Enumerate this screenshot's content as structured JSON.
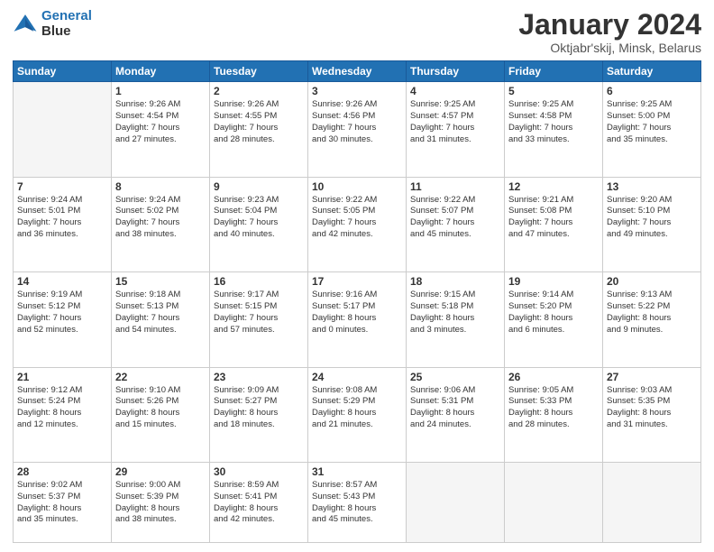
{
  "logo": {
    "line1": "General",
    "line2": "Blue"
  },
  "title": "January 2024",
  "location": "Oktjabr'skij, Minsk, Belarus",
  "days_header": [
    "Sunday",
    "Monday",
    "Tuesday",
    "Wednesday",
    "Thursday",
    "Friday",
    "Saturday"
  ],
  "weeks": [
    [
      {
        "num": "",
        "empty": true
      },
      {
        "num": "1",
        "sunrise": "Sunrise: 9:26 AM",
        "sunset": "Sunset: 4:54 PM",
        "daylight": "Daylight: 7 hours and 27 minutes."
      },
      {
        "num": "2",
        "sunrise": "Sunrise: 9:26 AM",
        "sunset": "Sunset: 4:55 PM",
        "daylight": "Daylight: 7 hours and 28 minutes."
      },
      {
        "num": "3",
        "sunrise": "Sunrise: 9:26 AM",
        "sunset": "Sunset: 4:56 PM",
        "daylight": "Daylight: 7 hours and 30 minutes."
      },
      {
        "num": "4",
        "sunrise": "Sunrise: 9:25 AM",
        "sunset": "Sunset: 4:57 PM",
        "daylight": "Daylight: 7 hours and 31 minutes."
      },
      {
        "num": "5",
        "sunrise": "Sunrise: 9:25 AM",
        "sunset": "Sunset: 4:58 PM",
        "daylight": "Daylight: 7 hours and 33 minutes."
      },
      {
        "num": "6",
        "sunrise": "Sunrise: 9:25 AM",
        "sunset": "Sunset: 5:00 PM",
        "daylight": "Daylight: 7 hours and 35 minutes."
      }
    ],
    [
      {
        "num": "7",
        "sunrise": "Sunrise: 9:24 AM",
        "sunset": "Sunset: 5:01 PM",
        "daylight": "Daylight: 7 hours and 36 minutes."
      },
      {
        "num": "8",
        "sunrise": "Sunrise: 9:24 AM",
        "sunset": "Sunset: 5:02 PM",
        "daylight": "Daylight: 7 hours and 38 minutes."
      },
      {
        "num": "9",
        "sunrise": "Sunrise: 9:23 AM",
        "sunset": "Sunset: 5:04 PM",
        "daylight": "Daylight: 7 hours and 40 minutes."
      },
      {
        "num": "10",
        "sunrise": "Sunrise: 9:22 AM",
        "sunset": "Sunset: 5:05 PM",
        "daylight": "Daylight: 7 hours and 42 minutes."
      },
      {
        "num": "11",
        "sunrise": "Sunrise: 9:22 AM",
        "sunset": "Sunset: 5:07 PM",
        "daylight": "Daylight: 7 hours and 45 minutes."
      },
      {
        "num": "12",
        "sunrise": "Sunrise: 9:21 AM",
        "sunset": "Sunset: 5:08 PM",
        "daylight": "Daylight: 7 hours and 47 minutes."
      },
      {
        "num": "13",
        "sunrise": "Sunrise: 9:20 AM",
        "sunset": "Sunset: 5:10 PM",
        "daylight": "Daylight: 7 hours and 49 minutes."
      }
    ],
    [
      {
        "num": "14",
        "sunrise": "Sunrise: 9:19 AM",
        "sunset": "Sunset: 5:12 PM",
        "daylight": "Daylight: 7 hours and 52 minutes."
      },
      {
        "num": "15",
        "sunrise": "Sunrise: 9:18 AM",
        "sunset": "Sunset: 5:13 PM",
        "daylight": "Daylight: 7 hours and 54 minutes."
      },
      {
        "num": "16",
        "sunrise": "Sunrise: 9:17 AM",
        "sunset": "Sunset: 5:15 PM",
        "daylight": "Daylight: 7 hours and 57 minutes."
      },
      {
        "num": "17",
        "sunrise": "Sunrise: 9:16 AM",
        "sunset": "Sunset: 5:17 PM",
        "daylight": "Daylight: 8 hours and 0 minutes."
      },
      {
        "num": "18",
        "sunrise": "Sunrise: 9:15 AM",
        "sunset": "Sunset: 5:18 PM",
        "daylight": "Daylight: 8 hours and 3 minutes."
      },
      {
        "num": "19",
        "sunrise": "Sunrise: 9:14 AM",
        "sunset": "Sunset: 5:20 PM",
        "daylight": "Daylight: 8 hours and 6 minutes."
      },
      {
        "num": "20",
        "sunrise": "Sunrise: 9:13 AM",
        "sunset": "Sunset: 5:22 PM",
        "daylight": "Daylight: 8 hours and 9 minutes."
      }
    ],
    [
      {
        "num": "21",
        "sunrise": "Sunrise: 9:12 AM",
        "sunset": "Sunset: 5:24 PM",
        "daylight": "Daylight: 8 hours and 12 minutes."
      },
      {
        "num": "22",
        "sunrise": "Sunrise: 9:10 AM",
        "sunset": "Sunset: 5:26 PM",
        "daylight": "Daylight: 8 hours and 15 minutes."
      },
      {
        "num": "23",
        "sunrise": "Sunrise: 9:09 AM",
        "sunset": "Sunset: 5:27 PM",
        "daylight": "Daylight: 8 hours and 18 minutes."
      },
      {
        "num": "24",
        "sunrise": "Sunrise: 9:08 AM",
        "sunset": "Sunset: 5:29 PM",
        "daylight": "Daylight: 8 hours and 21 minutes."
      },
      {
        "num": "25",
        "sunrise": "Sunrise: 9:06 AM",
        "sunset": "Sunset: 5:31 PM",
        "daylight": "Daylight: 8 hours and 24 minutes."
      },
      {
        "num": "26",
        "sunrise": "Sunrise: 9:05 AM",
        "sunset": "Sunset: 5:33 PM",
        "daylight": "Daylight: 8 hours and 28 minutes."
      },
      {
        "num": "27",
        "sunrise": "Sunrise: 9:03 AM",
        "sunset": "Sunset: 5:35 PM",
        "daylight": "Daylight: 8 hours and 31 minutes."
      }
    ],
    [
      {
        "num": "28",
        "sunrise": "Sunrise: 9:02 AM",
        "sunset": "Sunset: 5:37 PM",
        "daylight": "Daylight: 8 hours and 35 minutes."
      },
      {
        "num": "29",
        "sunrise": "Sunrise: 9:00 AM",
        "sunset": "Sunset: 5:39 PM",
        "daylight": "Daylight: 8 hours and 38 minutes."
      },
      {
        "num": "30",
        "sunrise": "Sunrise: 8:59 AM",
        "sunset": "Sunset: 5:41 PM",
        "daylight": "Daylight: 8 hours and 42 minutes."
      },
      {
        "num": "31",
        "sunrise": "Sunrise: 8:57 AM",
        "sunset": "Sunset: 5:43 PM",
        "daylight": "Daylight: 8 hours and 45 minutes."
      },
      {
        "num": "",
        "empty": true
      },
      {
        "num": "",
        "empty": true
      },
      {
        "num": "",
        "empty": true
      }
    ]
  ]
}
